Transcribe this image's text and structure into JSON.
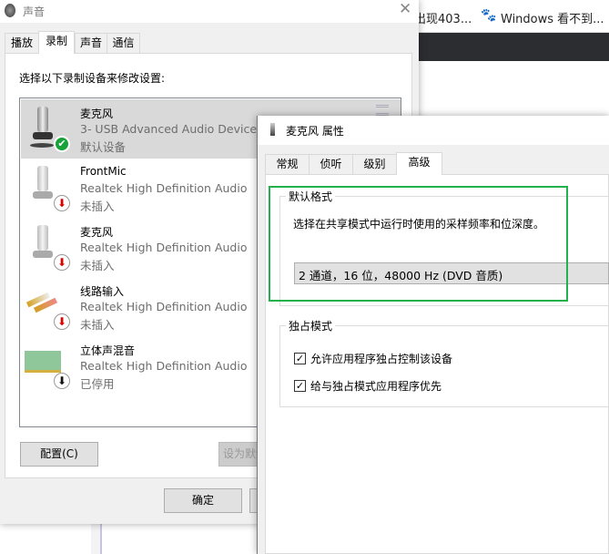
{
  "browser": {
    "tabs": [
      {
        "label": "出现403..."
      },
      {
        "label": "Windows 看不到..."
      }
    ]
  },
  "sound_dialog": {
    "title": "声音",
    "tabs": [
      {
        "label": "播放"
      },
      {
        "label": "录制"
      },
      {
        "label": "声音"
      },
      {
        "label": "通信"
      }
    ],
    "active_tab": "录制",
    "instruction": "选择以下录制设备来修改设置:",
    "devices": [
      {
        "name": "麦克风",
        "device": "3- USB Advanced Audio Device",
        "status": "默认设备",
        "badge": "check"
      },
      {
        "name": "FrontMic",
        "device": "Realtek High Definition Audio",
        "status": "未插入",
        "badge": "red-down"
      },
      {
        "name": "麦克风",
        "device": "Realtek High Definition Audio",
        "status": "未插入",
        "badge": "red-down"
      },
      {
        "name": "线路输入",
        "device": "Realtek High Definition Audio",
        "status": "未插入",
        "badge": "red-down"
      },
      {
        "name": "立体声混音",
        "device": "Realtek High Definition Audio",
        "status": "已停用",
        "badge": "black-down"
      }
    ],
    "configure_label": "配置(C)",
    "set_default_label": "设为默认",
    "ok_label": "确定"
  },
  "props_dialog": {
    "title": "麦克风 属性",
    "tabs": [
      {
        "label": "常规"
      },
      {
        "label": "侦听"
      },
      {
        "label": "级别"
      },
      {
        "label": "高级"
      }
    ],
    "active_tab": "高级",
    "default_format": {
      "group": "默认格式",
      "description": "选择在共享模式中运行时使用的采样频率和位深度。",
      "selected": "2 通道，16 位，48000 Hz (DVD 音质)"
    },
    "exclusive": {
      "group": "独占模式",
      "options": [
        {
          "label": "允许应用程序独占控制该设备",
          "checked": true
        },
        {
          "label": "给与独占模式应用程序优先",
          "checked": true
        }
      ]
    }
  },
  "colors": {
    "highlight": "#22b14c",
    "selected_row": "#d9d9d9"
  }
}
